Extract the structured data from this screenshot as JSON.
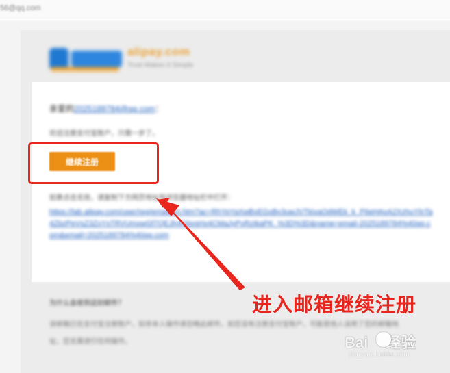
{
  "browser": {
    "address": "56@qq.com"
  },
  "email": {
    "logo": {
      "brand": "alipay.com",
      "mark": "支付宝",
      "tagline": "Trust Makes It Simple"
    },
    "greeting_prefix": "亲爱的",
    "greeting_email": "2025189784@qq.com",
    "greeting_suffix": "：",
    "intro": "欢迎注册支付宝账户，只需一步了。",
    "cta_label": "继续注册",
    "link_hint": "如果点击无效，请复制下方网页地址到浏览器地址栏中打开：",
    "link_url": "https://lab.alipay.com/user/reg/emailAct.htm?ac=RhYqYaXwBvEGxBv3uwJVTkivaOdWEk_k_P6eHAxA2XzhuYlnTa4ZbzPeVsZ3ZxYsTRVUmxwGf7QEJh4GbvsHx4CMaJyPvRzIkaPK_%3D%3D&name=email-2025189784%40qq.com&email=2025189784%40qq.com",
    "faq_question": "为什么会收到这封邮件？",
    "faq_answer": "该邮箱已在支付宝注册账户，如非本人操作请忽略此邮件。如您没有注册支付宝账户，可能是他人误用了您的邮箱地址，您无需进行任何操作。"
  },
  "annotation": {
    "text": "进入邮箱继续注册",
    "color": "#e8261e"
  },
  "watermark": {
    "main": "Bai",
    "main2": "经验",
    "sub": "jingyan.baidu.com"
  },
  "colors": {
    "cta": "#eb8f15",
    "link": "#1f5fbf",
    "highlight": "#e8261e"
  }
}
